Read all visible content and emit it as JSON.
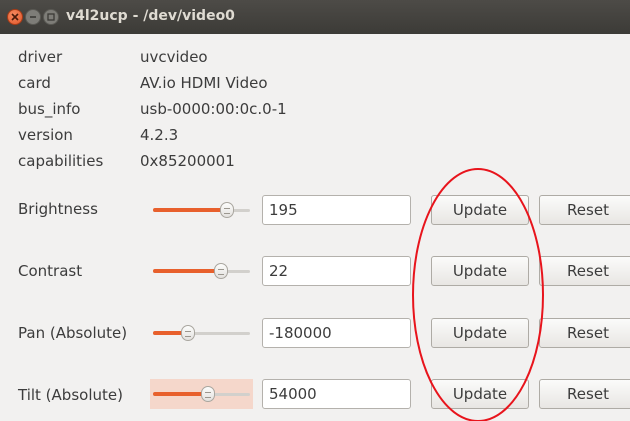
{
  "window": {
    "title": "v4l2ucp - /dev/video0"
  },
  "info": [
    {
      "label": "driver",
      "value": "uvcvideo"
    },
    {
      "label": "card",
      "value": "AV.io HDMI Video"
    },
    {
      "label": "bus_info",
      "value": "usb-0000:00:0c.0-1"
    },
    {
      "label": "version",
      "value": "4.2.3"
    },
    {
      "label": "capabilities",
      "value": "0x85200001"
    }
  ],
  "controls": [
    {
      "label": "Brightness",
      "value": "195",
      "slider_fraction": 0.76,
      "update_label": "Update",
      "reset_label": "Reset"
    },
    {
      "label": "Contrast",
      "value": "22",
      "slider_fraction": 0.7,
      "update_label": "Update",
      "reset_label": "Reset"
    },
    {
      "label": "Pan (Absolute)",
      "value": "-180000",
      "slider_fraction": 0.36,
      "update_label": "Update",
      "reset_label": "Reset"
    },
    {
      "label": "Tilt (Absolute)",
      "value": "54000",
      "slider_fraction": 0.57,
      "update_label": "Update",
      "reset_label": "Reset"
    }
  ],
  "colors": {
    "accent": "#e8602c",
    "annotation": "#e8141c"
  },
  "icons": [
    "close-icon",
    "minimize-icon",
    "maximize-icon",
    "slider-knob-icon"
  ]
}
